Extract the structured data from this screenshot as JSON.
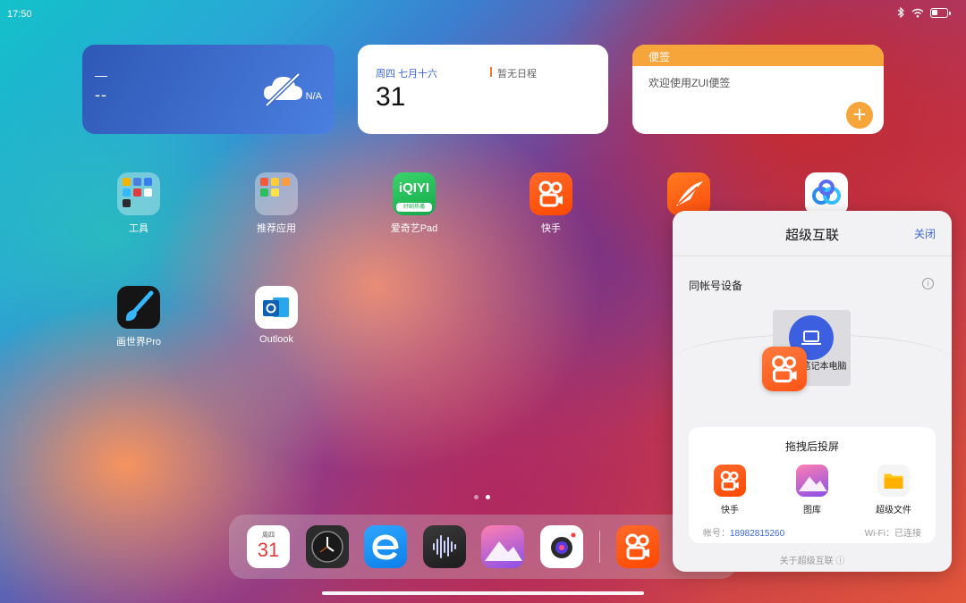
{
  "status_bar": {
    "time": "17:50",
    "icons": [
      "bluetooth-icon",
      "wifi-icon",
      "battery-icon"
    ]
  },
  "widgets": {
    "weather": {
      "line1": "—",
      "line2": "--",
      "status": "N/A",
      "icon": "cloud-off-icon"
    },
    "calendar": {
      "date_text": "周四 七月十六",
      "day": "31",
      "schedule_text": "暂无日程"
    },
    "note": {
      "title": "便签",
      "text": "欢迎使用ZUI便签",
      "add_label": "+"
    }
  },
  "apps": [
    {
      "label": "工具"
    },
    {
      "label": "推荐应用"
    },
    {
      "label": "爱奇艺Pad",
      "icon_text": "iQIYI",
      "icon_subtext": "好剧热播"
    },
    {
      "label": "快手"
    },
    {
      "label": ""
    },
    {
      "label": ""
    },
    {
      "label": "画世界Pro"
    },
    {
      "label": "Outlook"
    }
  ],
  "dock": {
    "calendar": {
      "weekday": "周四",
      "day": "31"
    },
    "apps": [
      "calendar-icon",
      "clock-icon",
      "browser-icon",
      "recorder-icon",
      "gallery-icon",
      "camera-icon",
      "kuaishou-icon"
    ]
  },
  "panel": {
    "title": "超级互联",
    "close_label": "关闭",
    "same_account_label": "同帐号设备",
    "device_label": "联想笔记本电脑",
    "cast_title": "拖拽后投屏",
    "cast_apps": [
      {
        "label": "快手"
      },
      {
        "label": "图库"
      },
      {
        "label": "超级文件"
      }
    ],
    "account_label": "帐号：",
    "account_value": "18982815260",
    "wifi_label": "Wi-Fi：已连接",
    "about_label": "关于超级互联 ⓘ"
  },
  "colors": {
    "accent_blue": "#3b66d8",
    "kuaishou_orange": "#ff5516",
    "note_orange": "#f6a53a"
  }
}
